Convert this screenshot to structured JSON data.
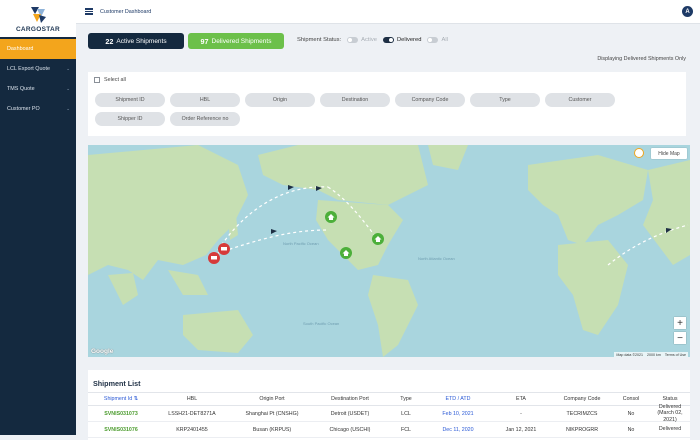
{
  "brand": {
    "name": "CARGOSTAR"
  },
  "sidebar": {
    "items": [
      {
        "label": "Dashboard",
        "active": true
      },
      {
        "label": "LCL Export Quote",
        "chevron": "⌄"
      },
      {
        "label": "TMS Quote",
        "chevron": "⌄"
      },
      {
        "label": "Customer PO",
        "chevron": "⌄"
      }
    ]
  },
  "header": {
    "breadcrumb": "Customer Dashboard",
    "user_initial": "A"
  },
  "summary": {
    "active_count": "22",
    "active_label": "Active Shipments",
    "delivered_count": "97",
    "delivered_label": "Delivered Shipments"
  },
  "status_filter": {
    "label": "Shipment Status:",
    "options": [
      "Active",
      "Delivered",
      "All"
    ],
    "selected": "Delivered"
  },
  "display_note": "Displaying Delivered Shipments Only",
  "filters": {
    "select_all": "Select all",
    "chips": [
      "Shipment ID",
      "HBL",
      "Origin",
      "Destination",
      "Company Code",
      "Type",
      "Customer",
      "Shipper ID",
      "Order Reference no"
    ]
  },
  "map": {
    "hide_map": "Hide Map",
    "zoom_in": "+",
    "zoom_out": "−",
    "google": "Google",
    "map_data": "Map data ©2021",
    "scale": "2000 km",
    "terms": "Terms of Use",
    "colors": {
      "water": "#a9d5de",
      "land": "#c6dfb3",
      "route": "#ffffff",
      "origin_marker": "#d63a3a",
      "dest_marker": "#4caf3a"
    }
  },
  "shipment_list": {
    "title": "Shipment List",
    "columns": [
      "Shipment Id ⇅",
      "HBL",
      "Origin Port",
      "Destination Port",
      "Type",
      "ETD / ATD",
      "ETA",
      "Company Code",
      "Consol",
      "Status"
    ],
    "rows": [
      {
        "id": "SVNIS031073",
        "hbl": "LSSH21-DET8271A",
        "origin": "Shanghai Pt (CNSHG)",
        "dest": "Detroit (USDET)",
        "type": "LCL",
        "etd": "Feb 10, 2021",
        "eta": "-",
        "company": "TECRIMZCS",
        "consol": "No",
        "status": "Delivered (March 02, 2021)"
      },
      {
        "id": "SVNIS031076",
        "hbl": "KRP2401455",
        "origin": "Busan (KRPUS)",
        "dest": "Chicago (USCHI)",
        "type": "FCL",
        "etd": "Dec 11, 2020",
        "eta": "Jan 12, 2021",
        "company": "NIKPROGRR",
        "consol": "No",
        "status": "Delivered"
      }
    ]
  }
}
